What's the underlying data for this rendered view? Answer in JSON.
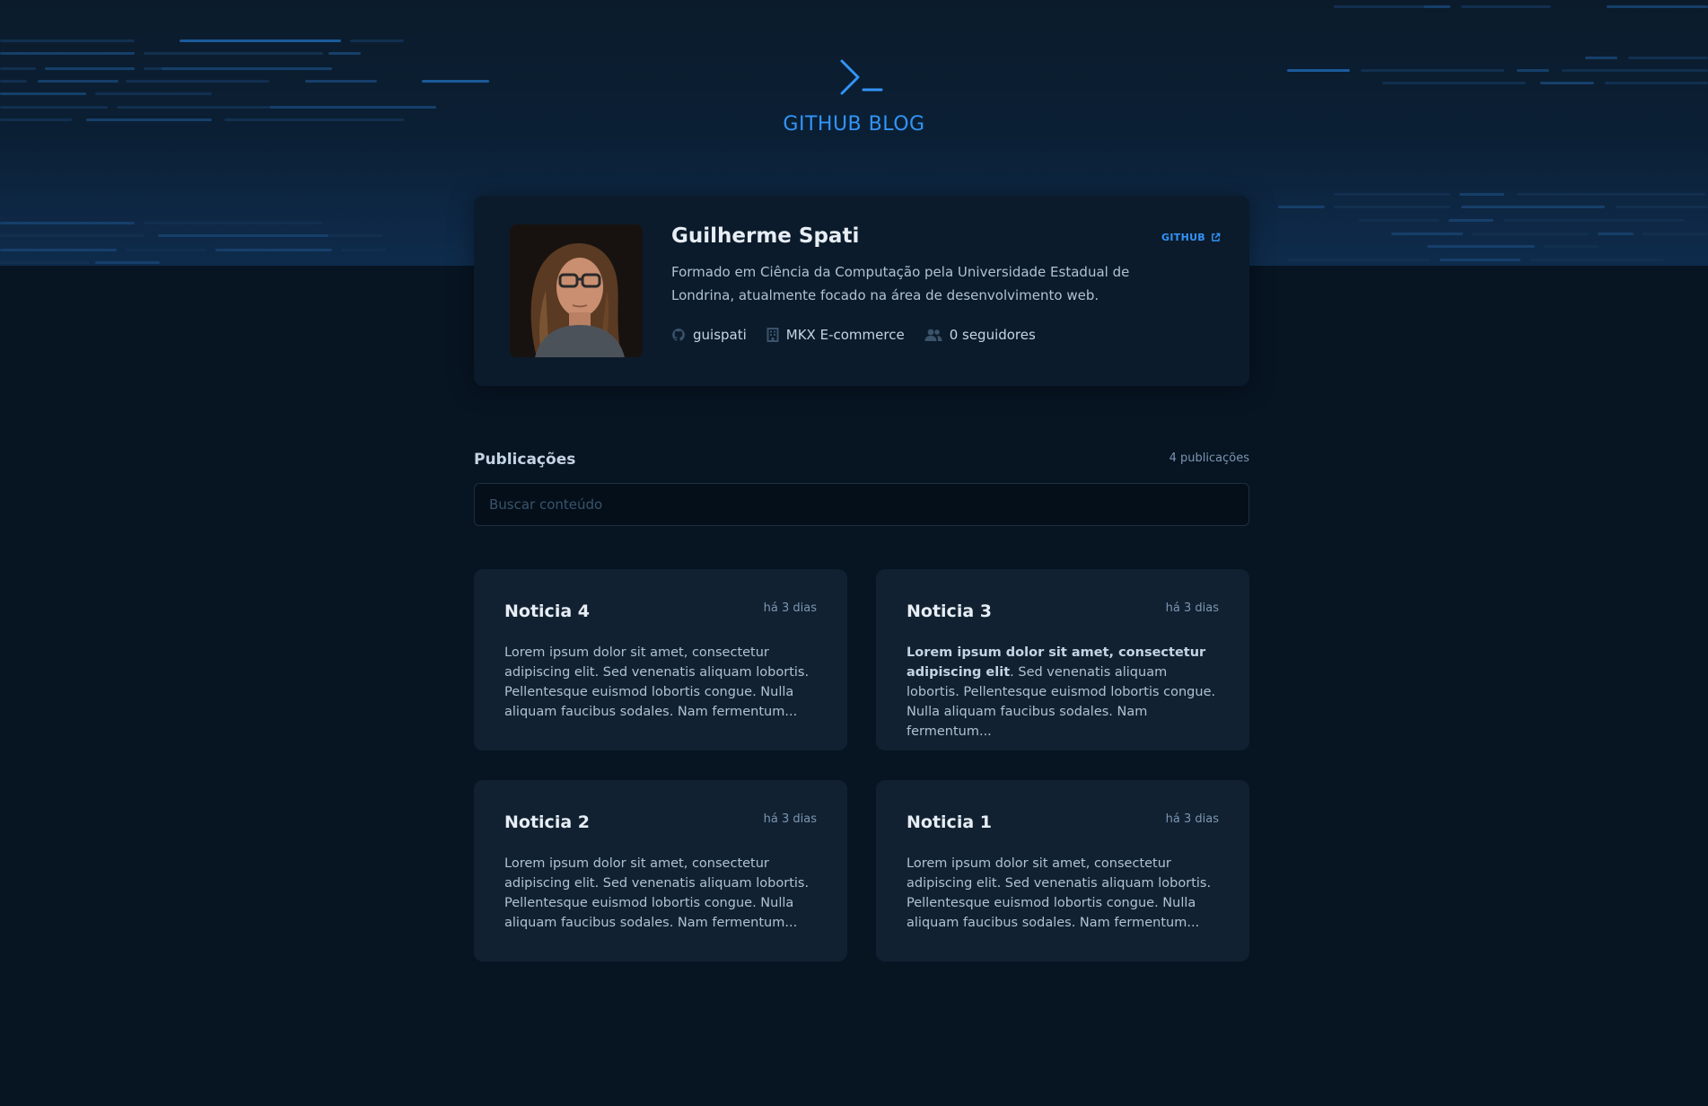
{
  "header": {
    "title": "GITHUB BLOG",
    "accent": "#3294f8"
  },
  "profile": {
    "name": "Guilherme Spati",
    "link_label": "GITHUB",
    "bio": "Formado em Ciência da Computação pela Universidade Estadual de Londrina, atualmente focado na área de desenvolvimento web.",
    "username": "guispati",
    "company": "MKX E-commerce",
    "followers": "0 seguidores"
  },
  "publications": {
    "title": "Publicações",
    "count": "4 publicações",
    "search_placeholder": "Buscar conteúdo"
  },
  "posts": [
    {
      "title": "Noticia 4",
      "date": "há 3 dias",
      "bold": "",
      "body": "Lorem ipsum dolor sit amet, consectetur adipiscing elit. Sed venenatis aliquam lobortis. Pellentesque euismod lobortis congue. Nulla aliquam faucibus sodales. Nam fermentum..."
    },
    {
      "title": "Noticia 3",
      "date": "há 3 dias",
      "bold": "Lorem ipsum dolor sit amet, consectetur adipiscing elit",
      "body": ". Sed venenatis aliquam lobortis. Pellentesque euismod lobortis congue. Nulla aliquam faucibus sodales. Nam fermentum..."
    },
    {
      "title": "Noticia 2",
      "date": "há 3 dias",
      "bold": "",
      "body": "Lorem ipsum dolor sit amet, consectetur adipiscing elit. Sed venenatis aliquam lobortis. Pellentesque euismod lobortis congue. Nulla aliquam faucibus sodales. Nam fermentum..."
    },
    {
      "title": "Noticia 1",
      "date": "há 3 dias",
      "bold": "",
      "body": "Lorem ipsum dolor sit amet, consectetur adipiscing elit. Sed venenatis aliquam lobortis. Pellentesque euismod lobortis congue. Nulla aliquam faucibus sodales. Nam fermentum..."
    }
  ],
  "icons": {
    "logo": "terminal-prompt-icon",
    "link": "external-link-icon",
    "username": "github-icon",
    "company": "building-icon",
    "followers": "users-icon"
  }
}
